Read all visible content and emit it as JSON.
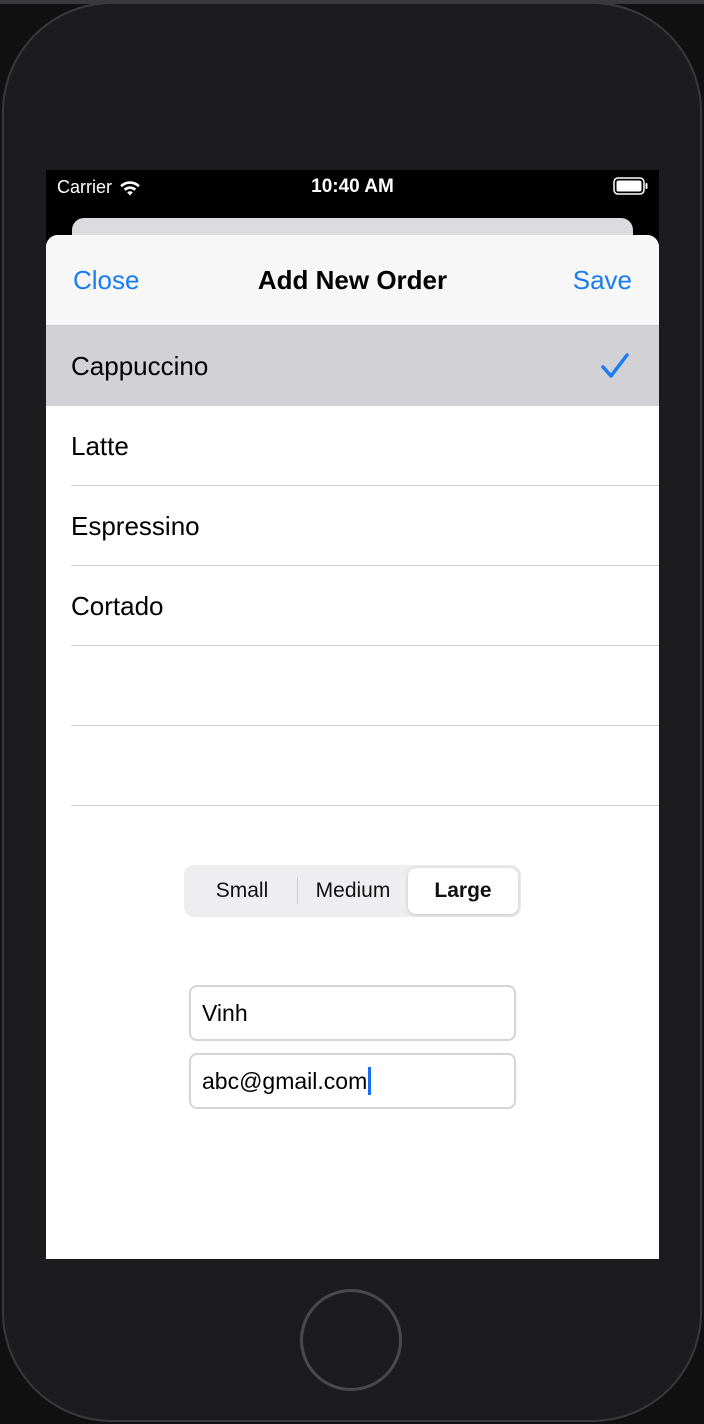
{
  "status_bar": {
    "carrier": "Carrier",
    "time": "10:40 AM"
  },
  "navbar": {
    "close_label": "Close",
    "title": "Add New Order",
    "save_label": "Save"
  },
  "coffee_list": {
    "items": [
      {
        "label": "Cappuccino",
        "selected": true
      },
      {
        "label": "Latte",
        "selected": false
      },
      {
        "label": "Espressino",
        "selected": false
      },
      {
        "label": "Cortado",
        "selected": false
      },
      {
        "label": "",
        "selected": false
      },
      {
        "label": "",
        "selected": false
      }
    ]
  },
  "size_picker": {
    "options": [
      "Small",
      "Medium",
      "Large"
    ],
    "selected": "Large"
  },
  "form": {
    "name_value": "Vinh",
    "email_value": "abc@gmail.com"
  },
  "colors": {
    "accent": "#1a7cf2",
    "selected_row": "#d1d1d6",
    "device_body": "#1c1c1e"
  },
  "icons": {
    "wifi": "wifi-icon",
    "battery": "battery-icon",
    "checkmark": "checkmark-icon"
  }
}
